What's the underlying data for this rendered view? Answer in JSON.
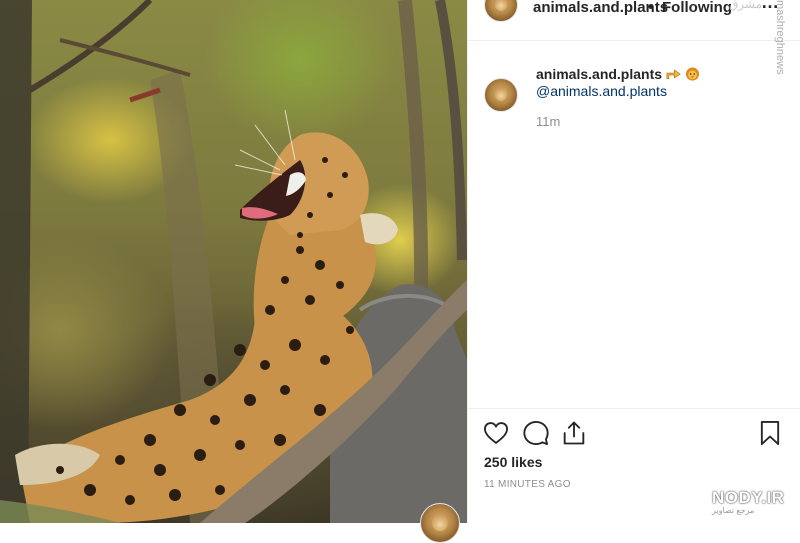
{
  "header": {
    "username": "animals.and.plants",
    "separator": "•",
    "follow_status": "Following",
    "more_icon": "ellipsis-icon",
    "more_label": "…"
  },
  "caption": {
    "username": "animals.and.plants",
    "emojis": [
      "pointing-hand-icon",
      "lion-face-icon"
    ],
    "mention": "@animals.and.plants",
    "time": "11m"
  },
  "actions": {
    "icons": [
      "heart-icon",
      "comment-icon",
      "share-icon",
      "bookmark-icon"
    ],
    "likes": "250 likes",
    "time_ago": "11 MINUTES AGO"
  },
  "watermarks": {
    "side": "mashreghnews",
    "top": "مشرق",
    "nody": "NODY.IR",
    "nody_sub": "مرجع تصاویر"
  },
  "colors": {
    "text": "#262626",
    "mention": "#003569",
    "muted": "#8e8e8e",
    "border": "#efefef"
  }
}
